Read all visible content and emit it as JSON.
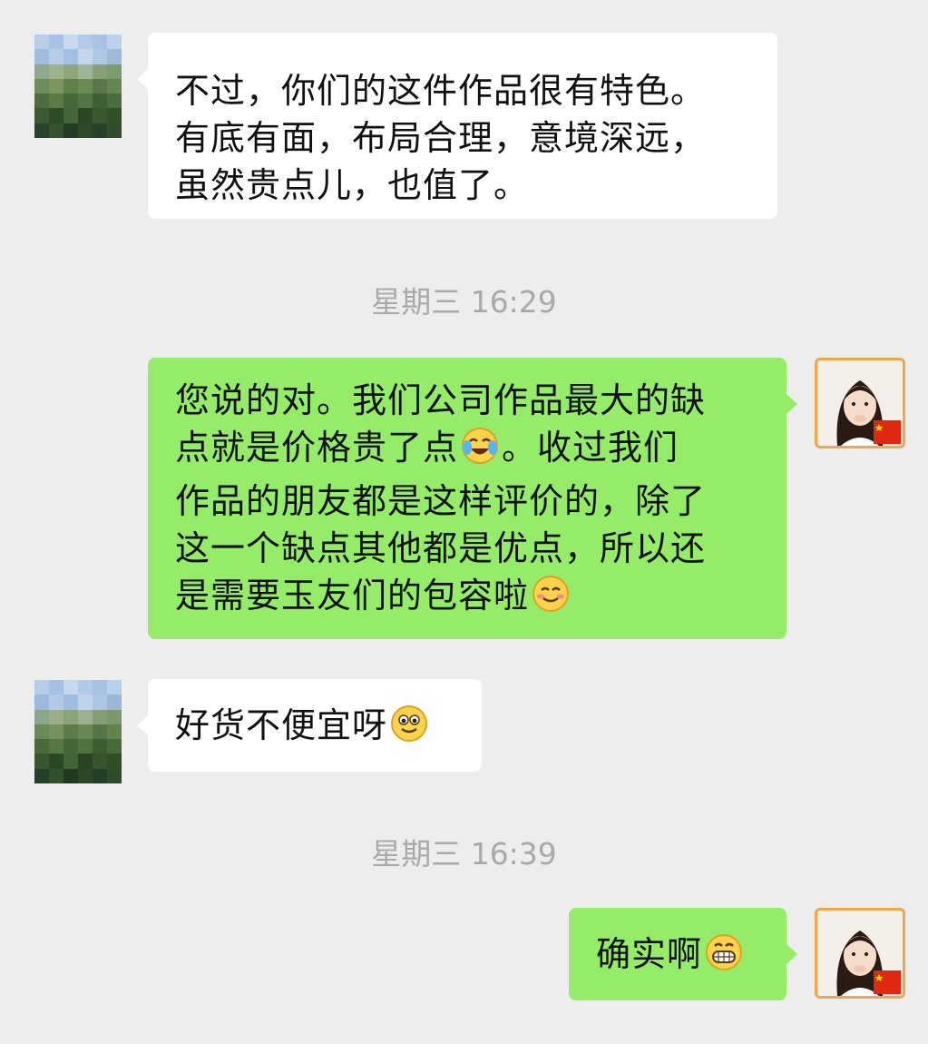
{
  "messages": [
    {
      "sender": "other",
      "lines": [
        "不过，你们的这件作品很有特色。",
        "有底有面，布局合理，意境深远，",
        "虽然贵点儿，也值了。"
      ]
    },
    {
      "sender": "self",
      "lines": [
        "您说的对。我们公司作品最大的缺",
        "点就是价格贵了点",
        "。收过我们",
        "作品的朋友都是这样评价的，除了",
        "这一个缺点其他都是优点，所以还",
        "是需要玉友们的包容啦"
      ],
      "emojis": [
        "crying-laughing-emoji-icon",
        "blushing-smile-emoji-icon"
      ]
    },
    {
      "sender": "other",
      "lines": [
        "好货不便宜呀"
      ],
      "emojis": [
        "smiley-face-emoji-icon"
      ]
    },
    {
      "sender": "self",
      "lines": [
        "确实啊"
      ],
      "emojis": [
        "grinning-teeth-emoji-icon"
      ]
    }
  ],
  "timestamps": [
    "星期三 16:29",
    "星期三 16:39"
  ],
  "colors": {
    "background": "#ededed",
    "incoming_bubble": "#ffffff",
    "outgoing_bubble": "#95ec69",
    "timestamp_text": "#a9a9a9",
    "avatar_border": "#f0a64b"
  }
}
